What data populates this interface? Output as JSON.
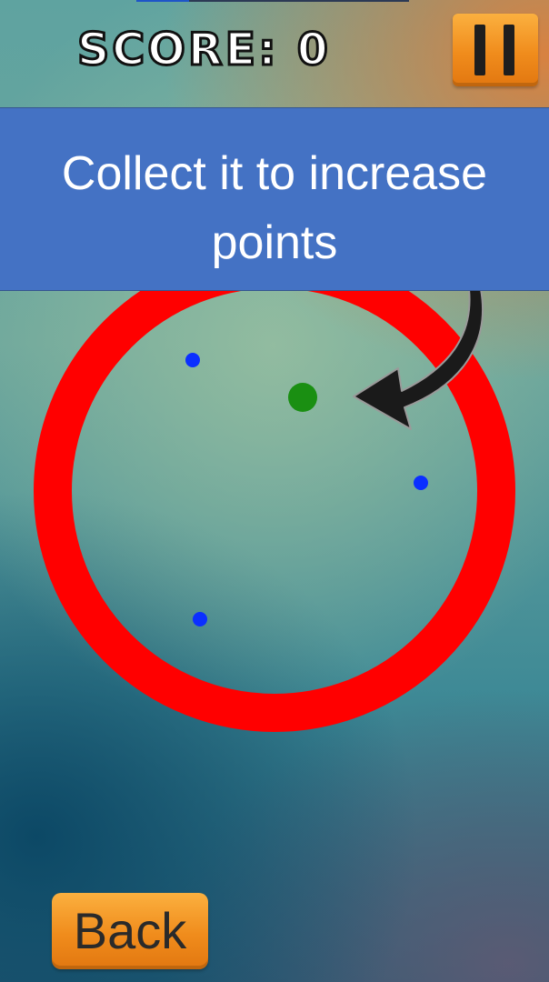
{
  "hud": {
    "score_text": "SCORE: 0",
    "pause_icon": "pause-icon"
  },
  "tutorial": {
    "message": "Collect it to increase points",
    "arrow_icon": "curved-arrow-icon"
  },
  "playfield": {
    "ring_color": "#ff0000",
    "collectible_color": "#1a8f12",
    "obstacle_color": "#0b2fff"
  },
  "nav": {
    "back_label": "Back"
  },
  "colors": {
    "banner": "#4472c4",
    "button": "#f39a2c"
  }
}
